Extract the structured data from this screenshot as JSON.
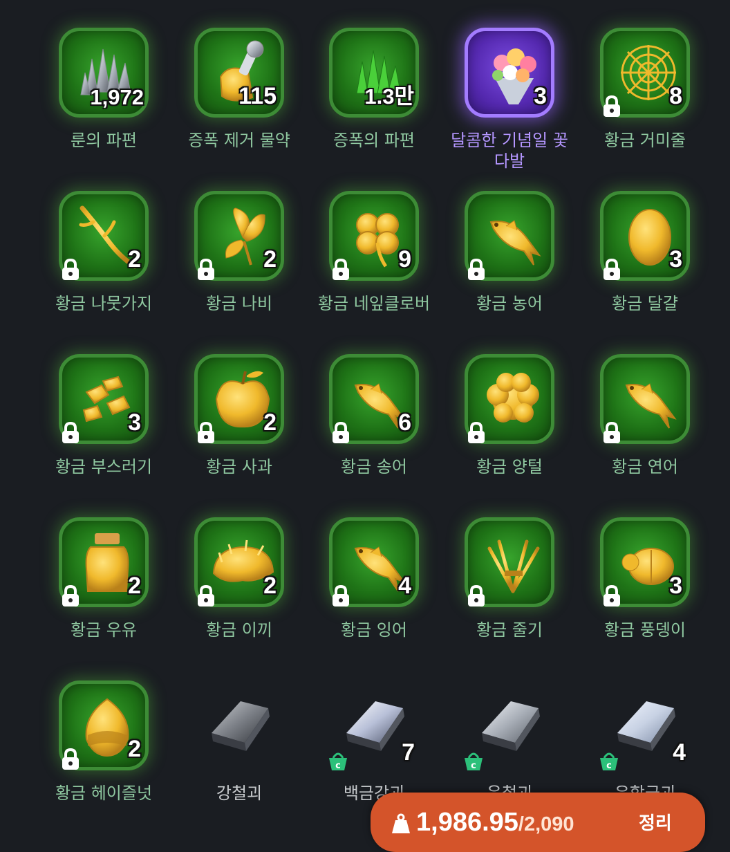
{
  "inventory": {
    "items": [
      {
        "name": "룬의 파편",
        "count": "1,972",
        "icon": "rune-shards-icon",
        "rarity": "green"
      },
      {
        "name": "증폭 제거 물약",
        "count": "115",
        "icon": "potion-icon",
        "rarity": "green"
      },
      {
        "name": "증폭의 파편",
        "count": "1.3만",
        "icon": "green-shards-icon",
        "rarity": "green"
      },
      {
        "name": "달콤한 기념일 꽃다발",
        "count": "3",
        "icon": "bouquet-icon",
        "rarity": "purple"
      },
      {
        "name": "황금 거미줄",
        "count": "8",
        "icon": "spiderweb-icon",
        "rarity": "green",
        "locked": true
      },
      {
        "name": "황금 나뭇가지",
        "count": "2",
        "icon": "branch-icon",
        "rarity": "green",
        "locked": true
      },
      {
        "name": "황금 나비",
        "count": "2",
        "icon": "butterfly-icon",
        "rarity": "green",
        "locked": true
      },
      {
        "name": "황금 네잎클로버",
        "count": "9",
        "icon": "clover-icon",
        "rarity": "green",
        "locked": true
      },
      {
        "name": "황금 농어",
        "count": "",
        "icon": "bass-fish-icon",
        "rarity": "green",
        "locked": true
      },
      {
        "name": "황금 달걀",
        "count": "3",
        "icon": "egg-icon",
        "rarity": "green",
        "locked": true
      },
      {
        "name": "황금 부스러기",
        "count": "3",
        "icon": "nuggets-icon",
        "rarity": "green",
        "locked": true
      },
      {
        "name": "황금 사과",
        "count": "2",
        "icon": "apple-icon",
        "rarity": "green",
        "locked": true
      },
      {
        "name": "황금 송어",
        "count": "6",
        "icon": "trout-icon",
        "rarity": "green",
        "locked": true
      },
      {
        "name": "황금 양털",
        "count": "",
        "icon": "wool-icon",
        "rarity": "green",
        "locked": true
      },
      {
        "name": "황금 연어",
        "count": "",
        "icon": "salmon-icon",
        "rarity": "green",
        "locked": true
      },
      {
        "name": "황금 우유",
        "count": "2",
        "icon": "milk-jar-icon",
        "rarity": "green",
        "locked": true
      },
      {
        "name": "황금 이끼",
        "count": "2",
        "icon": "moss-icon",
        "rarity": "green",
        "locked": true
      },
      {
        "name": "황금 잉어",
        "count": "4",
        "icon": "carp-icon",
        "rarity": "green",
        "locked": true
      },
      {
        "name": "황금 줄기",
        "count": "",
        "icon": "wheat-stalk-icon",
        "rarity": "green",
        "locked": true
      },
      {
        "name": "황금 풍뎅이",
        "count": "3",
        "icon": "beetle-icon",
        "rarity": "green",
        "locked": true
      },
      {
        "name": "황금 헤이즐넛",
        "count": "2",
        "icon": "hazelnut-icon",
        "rarity": "green",
        "locked": true
      },
      {
        "name": "강철괴",
        "count": "",
        "icon": "steel-ingot-icon",
        "rarity": "none"
      },
      {
        "name": "백금강괴",
        "count": "7",
        "icon": "platinum-ingot-icon",
        "rarity": "none",
        "basket": true
      },
      {
        "name": "운철괴",
        "count": "",
        "icon": "meteor-iron-ingot-icon",
        "rarity": "none",
        "basket": true
      },
      {
        "name": "은합금괴",
        "count": "4",
        "icon": "silver-alloy-ingot-icon",
        "rarity": "none",
        "basket": true
      }
    ]
  },
  "footer": {
    "weight": "1,986.95",
    "weight_max": "/2,090",
    "sort_label": "정리",
    "weight_icon": "weight-icon"
  },
  "colors": {
    "background": "#1a1d22",
    "tile_green": "#2a8a22",
    "tile_purple": "#6a3ad0",
    "label_green": "#8fc8a0",
    "label_purple": "#b496ff",
    "footer_bar": "#d4542a"
  }
}
